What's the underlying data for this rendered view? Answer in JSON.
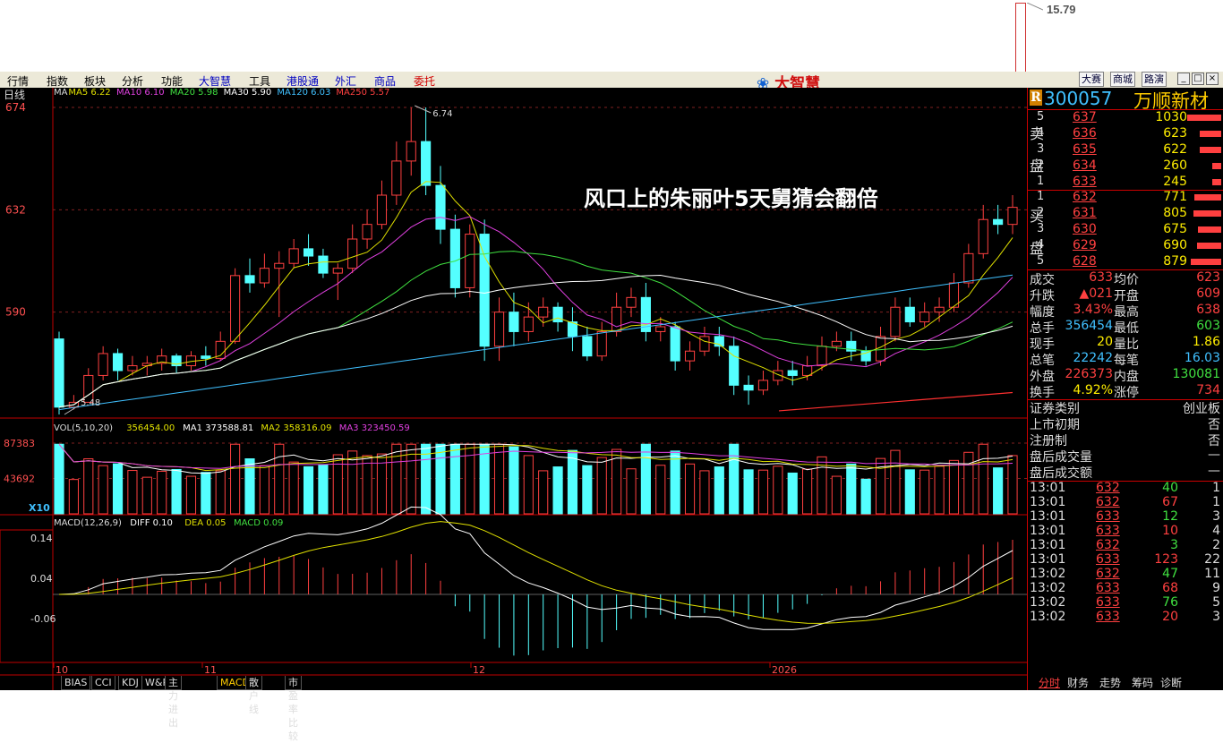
{
  "top": {
    "price_flag": "15.79"
  },
  "menu": [
    "行情",
    "指数",
    "板块",
    "分析",
    "功能",
    "大智慧",
    "工具",
    "港股通",
    "外汇",
    "商品",
    "委托"
  ],
  "logo_text": "大智慧",
  "right_buttons": [
    "大赛",
    "商城",
    "路演"
  ],
  "window_buttons": [
    "_",
    "□",
    "×"
  ],
  "chart": {
    "period": "日线",
    "ma_labels": [
      {
        "text": "MA",
        "color": "#dddddd"
      },
      {
        "text": "MA5 6.22",
        "color": "#e0e000"
      },
      {
        "text": "MA10 6.10",
        "color": "#e040e0"
      },
      {
        "text": "MA20 5.98",
        "color": "#40e040"
      },
      {
        "text": "MA30 5.90",
        "color": "#ffffff"
      },
      {
        "text": "MA120 6.03",
        "color": "#40c0ff"
      },
      {
        "text": "MA250 5.57",
        "color": "#ff4040"
      }
    ],
    "y_ticks": [
      "674",
      "632",
      "590"
    ],
    "high_label": "6.74",
    "low_label": "5.48",
    "overlay_text": "风口上的朱丽叶5天舅猜会翻倍",
    "vol_header": [
      {
        "text": "VOL(5,10,20)",
        "color": "#dddddd"
      },
      {
        "text": "356454.00",
        "color": "#e0e000"
      },
      {
        "text": "MA1 373588.81",
        "color": "#ffffff"
      },
      {
        "text": "MA2 358316.09",
        "color": "#e0e000"
      },
      {
        "text": "MA3 323450.59",
        "color": "#e040e0"
      }
    ],
    "vol_ticks": [
      "87383",
      "43692",
      "X10"
    ],
    "macd_header": [
      {
        "text": "MACD(12,26,9)",
        "color": "#dddddd"
      },
      {
        "text": "DIFF 0.10",
        "color": "#ffffff"
      },
      {
        "text": "DEA 0.05",
        "color": "#e0e000"
      },
      {
        "text": "MACD 0.09",
        "color": "#40e040"
      }
    ],
    "macd_ticks": [
      "0.14",
      "0.04",
      "-0.06"
    ],
    "x_labels": [
      "10",
      "11",
      "12",
      "2026"
    ],
    "tabs": [
      "BIAS",
      "CCI",
      "KDJ",
      "W&R",
      "主力进出",
      "MACD",
      "散户线",
      "市盈率比较"
    ]
  },
  "chart_data": {
    "type": "candlestick",
    "unit_note": "prices in yuan",
    "ylim": [
      5.48,
      6.74
    ],
    "candles": [
      [
        5.79,
        5.51,
        5.82,
        5.48
      ],
      [
        5.51,
        5.53,
        5.56,
        5.5
      ],
      [
        5.53,
        5.64,
        5.67,
        5.53
      ],
      [
        5.64,
        5.73,
        5.76,
        5.62
      ],
      [
        5.73,
        5.66,
        5.75,
        5.62
      ],
      [
        5.66,
        5.68,
        5.72,
        5.64
      ],
      [
        5.68,
        5.69,
        5.72,
        5.64
      ],
      [
        5.69,
        5.72,
        5.75,
        5.66
      ],
      [
        5.72,
        5.68,
        5.73,
        5.65
      ],
      [
        5.68,
        5.72,
        5.74,
        5.66
      ],
      [
        5.72,
        5.71,
        5.76,
        5.68
      ],
      [
        5.71,
        5.78,
        5.82,
        5.7
      ],
      [
        5.78,
        6.05,
        6.08,
        5.77
      ],
      [
        6.05,
        6.02,
        6.12,
        5.98
      ],
      [
        6.02,
        6.08,
        6.14,
        6.0
      ],
      [
        6.08,
        6.1,
        6.15,
        5.88
      ],
      [
        6.1,
        6.16,
        6.2,
        6.08
      ],
      [
        6.16,
        6.13,
        6.22,
        6.09
      ],
      [
        6.13,
        6.06,
        6.16,
        6.04
      ],
      [
        6.06,
        6.08,
        6.1,
        5.95
      ],
      [
        6.08,
        6.2,
        6.26,
        6.06
      ],
      [
        6.2,
        6.26,
        6.32,
        6.16
      ],
      [
        6.26,
        6.38,
        6.44,
        6.24
      ],
      [
        6.38,
        6.52,
        6.6,
        6.34
      ],
      [
        6.52,
        6.6,
        6.74,
        6.46
      ],
      [
        6.6,
        6.42,
        6.74,
        6.38
      ],
      [
        6.42,
        6.24,
        6.5,
        6.18
      ],
      [
        6.24,
        6.0,
        6.3,
        5.96
      ],
      [
        6.0,
        6.22,
        6.26,
        5.96
      ],
      [
        6.22,
        5.76,
        6.28,
        5.7
      ],
      [
        5.76,
        5.9,
        5.96,
        5.7
      ],
      [
        5.9,
        5.82,
        5.98,
        5.76
      ],
      [
        5.82,
        5.88,
        5.94,
        5.78
      ],
      [
        5.88,
        5.92,
        5.96,
        5.84
      ],
      [
        5.92,
        5.86,
        5.94,
        5.82
      ],
      [
        5.86,
        5.8,
        5.92,
        5.74
      ],
      [
        5.8,
        5.72,
        5.84,
        5.7
      ],
      [
        5.72,
        5.82,
        5.86,
        5.7
      ],
      [
        5.82,
        5.92,
        5.98,
        5.8
      ],
      [
        5.92,
        5.96,
        6.0,
        5.88
      ],
      [
        5.96,
        5.82,
        6.02,
        5.78
      ],
      [
        5.82,
        5.84,
        5.88,
        5.78
      ],
      [
        5.84,
        5.7,
        5.86,
        5.66
      ],
      [
        5.7,
        5.74,
        5.78,
        5.66
      ],
      [
        5.74,
        5.8,
        5.84,
        5.72
      ],
      [
        5.8,
        5.76,
        5.84,
        5.72
      ],
      [
        5.76,
        5.6,
        5.8,
        5.56
      ],
      [
        5.6,
        5.58,
        5.64,
        5.52
      ],
      [
        5.58,
        5.62,
        5.66,
        5.56
      ],
      [
        5.62,
        5.66,
        5.7,
        5.6
      ],
      [
        5.66,
        5.64,
        5.7,
        5.6
      ],
      [
        5.64,
        5.68,
        5.72,
        5.62
      ],
      [
        5.68,
        5.76,
        5.8,
        5.66
      ],
      [
        5.76,
        5.78,
        5.82,
        5.74
      ],
      [
        5.78,
        5.74,
        5.82,
        5.7
      ],
      [
        5.74,
        5.7,
        5.76,
        5.68
      ],
      [
        5.7,
        5.8,
        5.84,
        5.68
      ],
      [
        5.8,
        5.92,
        5.96,
        5.78
      ],
      [
        5.92,
        5.86,
        5.96,
        5.84
      ],
      [
        5.86,
        5.9,
        5.94,
        5.84
      ],
      [
        5.9,
        5.92,
        5.96,
        5.86
      ],
      [
        5.92,
        6.02,
        6.06,
        5.9
      ],
      [
        6.02,
        6.14,
        6.18,
        6.0
      ],
      [
        6.14,
        6.28,
        6.34,
        6.12
      ],
      [
        6.28,
        6.26,
        6.34,
        6.22
      ],
      [
        6.26,
        6.33,
        6.38,
        6.22
      ]
    ]
  },
  "quote": {
    "badge": "R",
    "code": "300057",
    "name": "万顺新材",
    "sell_label": [
      "卖",
      "盘"
    ],
    "buy_label": [
      "买",
      "盘"
    ],
    "asks": [
      {
        "lvl": "5",
        "price": "637",
        "vol": "1030",
        "bar": 0.95
      },
      {
        "lvl": "4",
        "price": "636",
        "vol": "623",
        "bar": 0.6
      },
      {
        "lvl": "3",
        "price": "635",
        "vol": "622",
        "bar": 0.6
      },
      {
        "lvl": "2",
        "price": "634",
        "vol": "260",
        "bar": 0.25
      },
      {
        "lvl": "1",
        "price": "633",
        "vol": "245",
        "bar": 0.24
      }
    ],
    "bids": [
      {
        "lvl": "1",
        "price": "632",
        "vol": "771",
        "bar": 0.75
      },
      {
        "lvl": "2",
        "price": "631",
        "vol": "805",
        "bar": 0.78
      },
      {
        "lvl": "3",
        "price": "630",
        "vol": "675",
        "bar": 0.66
      },
      {
        "lvl": "4",
        "price": "629",
        "vol": "690",
        "bar": 0.67
      },
      {
        "lvl": "5",
        "price": "628",
        "vol": "879",
        "bar": 0.85
      }
    ],
    "stats": [
      [
        "成交",
        "633",
        "均价",
        "623"
      ],
      [
        "升跌",
        "▲021",
        "开盘",
        "609"
      ],
      [
        "幅度",
        "3.43%",
        "最高",
        "638"
      ],
      [
        "总手",
        "356454",
        "最低",
        "603"
      ],
      [
        "现手",
        "20",
        "量比",
        "1.86"
      ],
      [
        "总笔",
        "22242",
        "每笔",
        "16.03"
      ],
      [
        "外盘",
        "226373",
        "内盘",
        "130081"
      ],
      [
        "换手",
        "4.92%",
        "涨停",
        "734"
      ]
    ],
    "info": [
      [
        "证券类别",
        "创业板"
      ],
      [
        "上市初期",
        "否"
      ],
      [
        "注册制",
        "否"
      ],
      [
        "盘后成交量",
        "—"
      ],
      [
        "盘后成交额",
        "—"
      ]
    ],
    "ticks": [
      [
        "13:01",
        "632",
        "40",
        "1"
      ],
      [
        "13:01",
        "632",
        "67",
        "1"
      ],
      [
        "13:01",
        "633",
        "12",
        "3"
      ],
      [
        "13:01",
        "633",
        "10",
        "4"
      ],
      [
        "13:01",
        "632",
        "3",
        "2"
      ],
      [
        "13:01",
        "633",
        "123",
        "22"
      ],
      [
        "13:02",
        "632",
        "47",
        "11"
      ],
      [
        "13:02",
        "633",
        "68",
        "9"
      ],
      [
        "13:02",
        "633",
        "76",
        "5"
      ],
      [
        "13:02",
        "633",
        "20",
        "3"
      ]
    ],
    "bottom_tabs": [
      "分时",
      "财务",
      "走势",
      "筹码",
      "诊断"
    ]
  }
}
